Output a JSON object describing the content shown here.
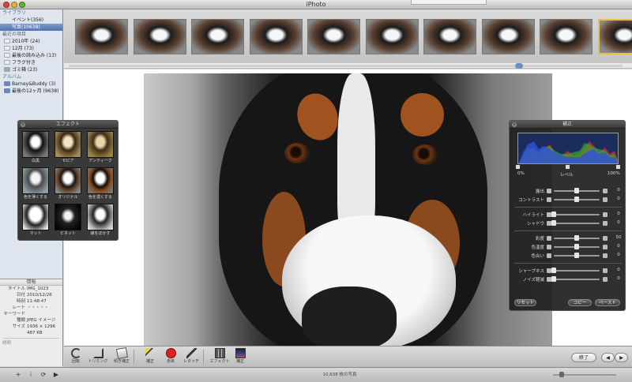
{
  "window": {
    "title": "iPhoto"
  },
  "sidebar": {
    "sections": [
      {
        "header": "ライブラリ",
        "items": [
          {
            "label": "イベント(356)",
            "icon": "events-icon",
            "selected": false
          },
          {
            "label": "写真(10638)",
            "icon": "photos-icon",
            "selected": true
          }
        ]
      },
      {
        "header": "最近の項目",
        "items": [
          {
            "label": "2010年 (24)",
            "icon": "calendar-icon",
            "selected": false
          },
          {
            "label": "12月 (73)",
            "icon": "calendar-icon",
            "selected": false
          },
          {
            "label": "最後の読み込み (13)",
            "icon": "import-icon",
            "selected": false
          },
          {
            "label": "フラグ付き",
            "icon": "flag-icon",
            "selected": false
          },
          {
            "label": "ゴミ箱 (23)",
            "icon": "trash-icon",
            "selected": false
          }
        ]
      },
      {
        "header": "アルバム",
        "items": [
          {
            "label": "Barney&Buddy (3)",
            "icon": "album-icon",
            "selected": false
          },
          {
            "label": "最後の12ヶ月 (9638)",
            "icon": "album-icon",
            "selected": false
          }
        ]
      }
    ]
  },
  "info": {
    "header": "情報",
    "rows": [
      {
        "k": "タイトル",
        "v": "IMG_1023"
      },
      {
        "k": "日付",
        "v": "2010/12/26"
      },
      {
        "k": "時刻",
        "v": "11:48:47"
      },
      {
        "k": "レート",
        "v": "・・・・・"
      },
      {
        "k": "キーワード",
        "v": ""
      },
      {
        "k": "種類",
        "v": "JPEG イメージ"
      },
      {
        "k": "サイズ",
        "v": "1936 × 1296"
      },
      {
        "k": "",
        "v": "487 KB"
      }
    ],
    "comment": "説明"
  },
  "filmstrip": {
    "count": 10,
    "selected_index": 9
  },
  "effects": {
    "title": "エフェクト",
    "items": [
      {
        "label": "白黒",
        "tone": "bw"
      },
      {
        "label": "セピア",
        "tone": "sepia"
      },
      {
        "label": "アンティーク",
        "tone": "antique"
      },
      {
        "label": "色を薄くする",
        "tone": "fade"
      },
      {
        "label": "オリジナル",
        "tone": "orig"
      },
      {
        "label": "色を濃くする",
        "tone": "boost"
      },
      {
        "label": "マット",
        "tone": "matte"
      },
      {
        "label": "ビネット",
        "tone": "vignette"
      },
      {
        "label": "縁をぼかす",
        "tone": "edge"
      }
    ]
  },
  "adjust": {
    "title": "補正",
    "levels": {
      "low": "0%",
      "mid": "レベル",
      "high": "100%"
    },
    "rows": [
      {
        "group": 1,
        "name": "露出",
        "value": "0",
        "pos": 0.5
      },
      {
        "group": 1,
        "name": "コントラスト",
        "value": "0",
        "pos": 0.5
      },
      {
        "group": 2,
        "name": "ハイライト",
        "value": "0",
        "pos": 0.0
      },
      {
        "group": 2,
        "name": "シャドウ",
        "value": "0",
        "pos": 0.0
      },
      {
        "group": 3,
        "name": "彩度",
        "value": "50",
        "pos": 0.5
      },
      {
        "group": 3,
        "name": "色温度",
        "value": "0",
        "pos": 0.5
      },
      {
        "group": 3,
        "name": "色合い",
        "value": "0",
        "pos": 0.5
      },
      {
        "group": 4,
        "name": "シャープネス",
        "value": "0",
        "pos": 0.0
      },
      {
        "group": 4,
        "name": "ノイズ軽減",
        "value": "0",
        "pos": 0.0
      }
    ],
    "buttons": {
      "reset": "リセット",
      "copy": "コピー",
      "paste": "ペースト"
    }
  },
  "toolbar": {
    "tools": [
      {
        "label": "回転",
        "icon": "rotate-icon"
      },
      {
        "label": "トリミング",
        "icon": "crop-icon"
      },
      {
        "label": "傾き補正",
        "icon": "straighten-icon"
      },
      {
        "label": "補正",
        "icon": "enhance-icon"
      },
      {
        "label": "赤目",
        "icon": "red-eye-icon"
      },
      {
        "label": "レタッチ",
        "icon": "retouch-icon"
      },
      {
        "label": "エフェクト",
        "icon": "effects-icon"
      },
      {
        "label": "補正",
        "icon": "adjust-icon"
      }
    ],
    "done": "終了",
    "prev": "◀",
    "next": "▶"
  },
  "statusbar": {
    "add": "+",
    "info": "i",
    "text": "10,638 枚の写真"
  }
}
